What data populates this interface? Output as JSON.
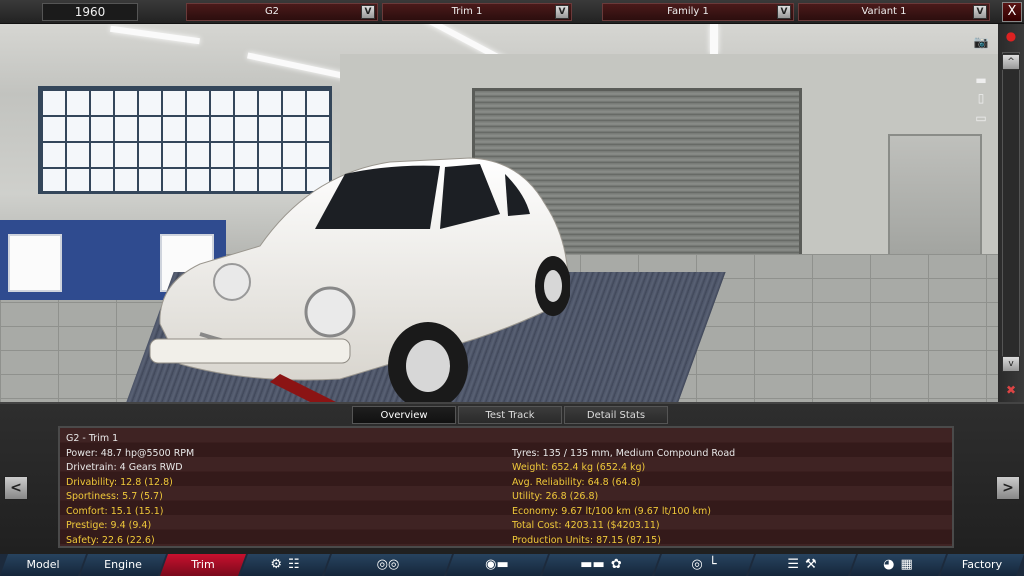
{
  "topbar": {
    "year": "1960",
    "selectors": [
      {
        "id": "model",
        "label": "G2"
      },
      {
        "id": "trim",
        "label": "Trim 1"
      },
      {
        "id": "family",
        "label": "Family 1"
      },
      {
        "id": "variant",
        "label": "Variant 1"
      }
    ],
    "dropdown_glyph": "V",
    "close_glyph": "X"
  },
  "sidebar": {
    "icons": [
      "camera-icon",
      "record-icon",
      "car-side-icon",
      "car-front-icon",
      "car-rear-icon",
      "car-top-icon",
      "delete-icon"
    ],
    "scroll_up": "^",
    "scroll_down": "v"
  },
  "tabs": [
    "Overview",
    "Test Track",
    "Detail Stats"
  ],
  "active_tab": "Overview",
  "stats": {
    "title": "G2 - Trim 1",
    "left": [
      {
        "text": "Power: 48.7 hp@5500 RPM",
        "highlight": false
      },
      {
        "text": "Drivetrain: 4 Gears RWD",
        "highlight": false
      },
      {
        "text": "Drivability: 12.8 (12.8)",
        "highlight": true
      },
      {
        "text": "Sportiness: 5.7 (5.7)",
        "highlight": true
      },
      {
        "text": "Comfort: 15.1 (15.1)",
        "highlight": true
      },
      {
        "text": "Prestige: 9.4 (9.4)",
        "highlight": true
      },
      {
        "text": "Safety: 22.6 (22.6)",
        "highlight": true
      }
    ],
    "right": [
      {
        "text": "Tyres: 135 / 135 mm, Medium Compound Road",
        "highlight": false
      },
      {
        "text": "Weight: 652.4 kg (652.4 kg)",
        "highlight": true
      },
      {
        "text": "Avg. Reliability: 64.8 (64.8)",
        "highlight": true
      },
      {
        "text": "Utility: 26.8 (26.8)",
        "highlight": true
      },
      {
        "text": "Economy: 9.67 lt/100 km (9.67 lt/100 km)",
        "highlight": true
      },
      {
        "text": "Total Cost: 4203.11 ($4203.11)",
        "highlight": true
      },
      {
        "text": "Production Units: 87.15 (87.15)",
        "highlight": true
      }
    ]
  },
  "nav_arrows": {
    "left": "<",
    "right": ">"
  },
  "bottom_nav": {
    "model": "Model",
    "engine": "Engine",
    "trim": "Trim",
    "factory": "Factory",
    "active": "Trim"
  },
  "colors": {
    "highlight_text": "#f0c93a",
    "active_nav": "#c8102e",
    "stats_bg": "#3b1f1f"
  }
}
